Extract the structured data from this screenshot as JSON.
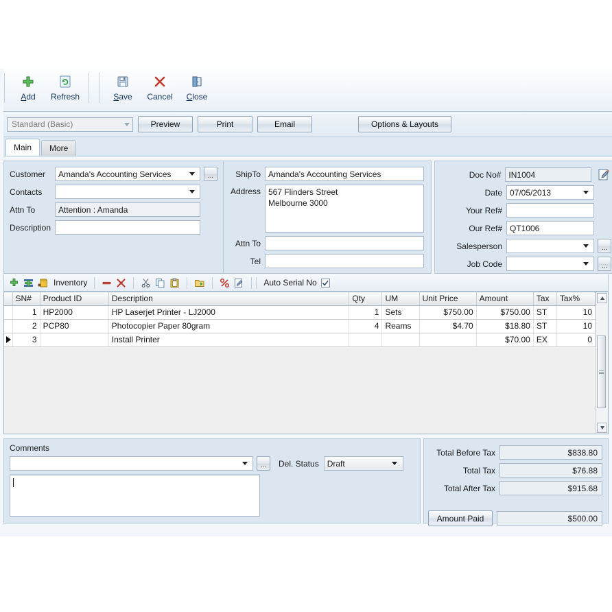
{
  "toolbar": {
    "buttons": [
      {
        "name": "add",
        "label": "Add",
        "accel": "A",
        "icon": "plus-icon"
      },
      {
        "name": "refresh",
        "label": "Refresh",
        "accel": "",
        "icon": "refresh-icon"
      },
      {
        "name": "save",
        "label": "Save",
        "accel": "S",
        "icon": "save-disk-icon"
      },
      {
        "name": "cancel",
        "label": "Cancel",
        "accel": "",
        "icon": "cancel-x-icon"
      },
      {
        "name": "close",
        "label": "Close",
        "accel": "C",
        "icon": "close-door-icon"
      }
    ]
  },
  "bar2": {
    "layout_select": "Standard (Basic)",
    "preview": "Preview",
    "print": "Print",
    "email": "Email",
    "options_layouts": "Options & Layouts"
  },
  "tabs": [
    {
      "label": "Main",
      "active": true
    },
    {
      "label": "More",
      "active": false
    }
  ],
  "customer_panel": {
    "customer_label": "Customer",
    "customer_value": "Amanda's Accounting Services",
    "contacts_label": "Contacts",
    "contacts_value": "",
    "attn_label": "Attn To",
    "attn_value": "Attention : Amanda",
    "description_label": "Description",
    "description_value": "",
    "browse": "..."
  },
  "ship_panel": {
    "shipto_label": "ShipTo",
    "shipto_value": "Amanda's Accounting Services",
    "address_label": "Address",
    "address_line1": "567 Flinders Street",
    "address_line2": "Melbourne 3000",
    "attn_label": "Attn To",
    "attn_value": "",
    "tel_label": "Tel",
    "tel_value": ""
  },
  "doc_panel": {
    "docno_label": "Doc No#",
    "docno_value": "IN1004",
    "date_label": "Date",
    "date_value": "07/05/2013",
    "yourref_label": "Your Ref#",
    "yourref_value": "",
    "ourref_label": "Our Ref#",
    "ourref_value": "QT1006",
    "salesperson_label": "Salesperson",
    "salesperson_value": "",
    "jobcode_label": "Job Code",
    "jobcode_value": "",
    "browse": "...",
    "edit_icon": "pencil-edit-icon"
  },
  "grid_toolbar": {
    "inventory_label": "Inventory",
    "auto_serial_label": "Auto Serial No",
    "auto_serial_checked": true,
    "icons": [
      "add-row-icon",
      "insert-row-icon",
      "inventory-icon",
      "remove-row-icon",
      "delete-row-icon",
      "cut-icon",
      "copy-icon",
      "paste-icon",
      "export-icon",
      "percent-icon",
      "edit-pencil-icon"
    ]
  },
  "grid": {
    "columns": [
      "SN#",
      "Product ID",
      "Description",
      "Qty",
      "UM",
      "Unit Price",
      "Amount",
      "Tax",
      "Tax%"
    ],
    "rows": [
      {
        "sn": "1",
        "product_id": "HP2000",
        "description": "HP Laserjet Printer - LJ2000",
        "qty": "1",
        "um": "Sets",
        "unit_price": "$750.00",
        "amount": "$750.00",
        "tax": "ST",
        "tax_pct": "10",
        "selected": false
      },
      {
        "sn": "2",
        "product_id": "PCP80",
        "description": "Photocopier Paper 80gram",
        "qty": "4",
        "um": "Reams",
        "unit_price": "$4.70",
        "amount": "$18.80",
        "tax": "ST",
        "tax_pct": "10",
        "selected": false
      },
      {
        "sn": "3",
        "product_id": "",
        "description": "Install Printer",
        "qty": "",
        "um": "",
        "unit_price": "",
        "amount": "$70.00",
        "tax": "EX",
        "tax_pct": "0",
        "selected": true
      }
    ]
  },
  "comments": {
    "label": "Comments",
    "combo_value": "",
    "browse": "...",
    "del_status_label": "Del. Status",
    "del_status_value": "Draft",
    "textarea_value": ""
  },
  "totals": {
    "rows": [
      {
        "label": "Total Before Tax",
        "value": "$838.80"
      },
      {
        "label": "Total Tax",
        "value": "$76.88"
      },
      {
        "label": "Total After Tax",
        "value": "$915.68"
      }
    ],
    "amount_paid_label": "Amount Paid",
    "amount_paid_value": "$500.00"
  },
  "colors": {
    "panel": "#dbe6f1",
    "panel_border": "#b3c6d8",
    "tax_cell": "#ccd9e8",
    "field_readonly": "#eaeff4",
    "accent_green": "#3aa33a",
    "accent_red": "#c0392b"
  }
}
